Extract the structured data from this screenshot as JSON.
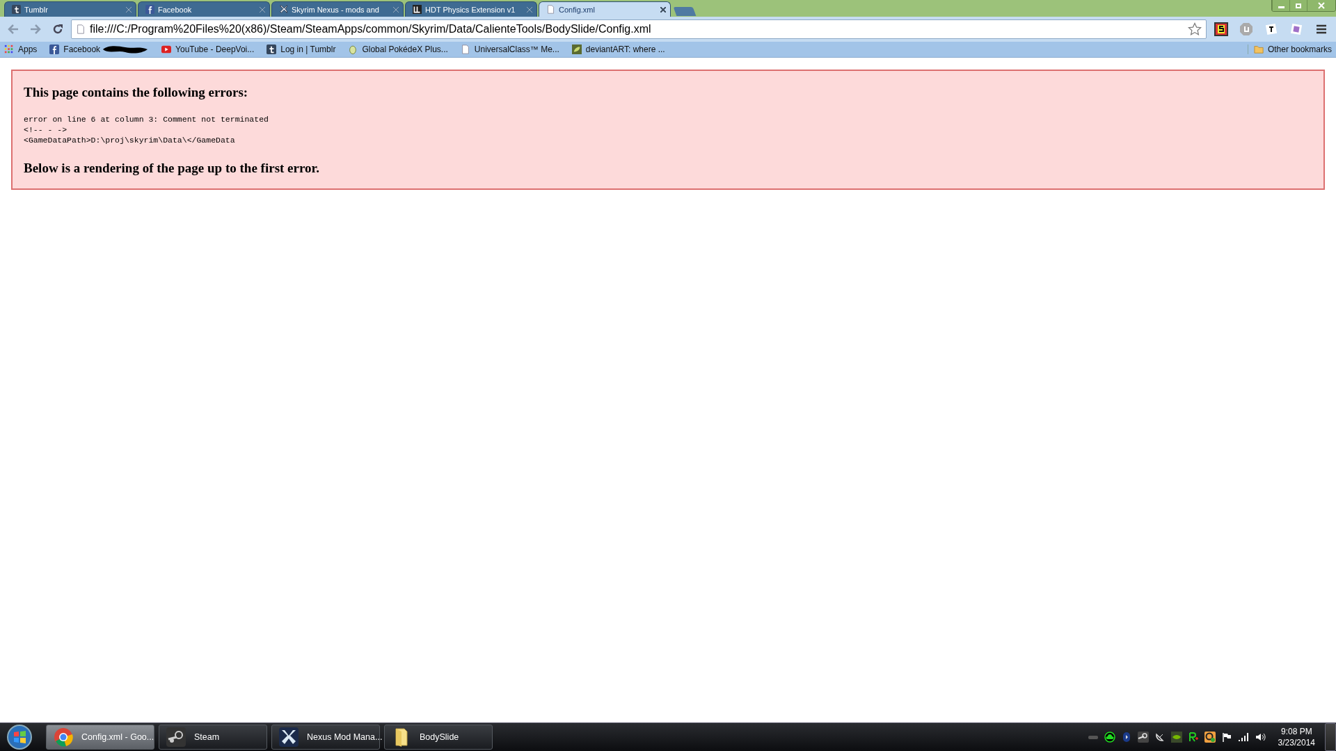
{
  "tabs": [
    {
      "title": "Tumblr",
      "selected": false
    },
    {
      "title": "Facebook",
      "selected": false
    },
    {
      "title": "Skyrim Nexus - mods and",
      "selected": false
    },
    {
      "title": "HDT Physics Extension v1",
      "selected": false
    },
    {
      "title": "Config.xml",
      "selected": true
    }
  ],
  "address": "file:///C:/Program%20Files%20(x86)/Steam/SteamApps/common/Skyrim/Data/CalienteTools/BodySlide/Config.xml",
  "bookmarks": [
    {
      "label": "Apps"
    },
    {
      "label": "Facebook"
    },
    {
      "label": "YouTube - DeepVoi..."
    },
    {
      "label": "Log in | Tumblr"
    },
    {
      "label": "Global PokédeX Plus..."
    },
    {
      "label": "UniversalClass™ Me..."
    },
    {
      "label": "deviantART: where ..."
    }
  ],
  "other_bookmarks": "Other bookmarks",
  "error": {
    "heading": "This page contains the following errors:",
    "lines": [
      "error on line 6 at column 3: Comment not terminated",
      "<!-- - ->",
      "<GameDataPath>D:\\proj\\skyrim\\Data\\</GameData"
    ],
    "footer": "Below is a rendering of the page up to the first error."
  },
  "taskbar": [
    {
      "label": "Config.xml - Goo...",
      "selected": true
    },
    {
      "label": "Steam",
      "selected": false
    },
    {
      "label": "Nexus Mod Mana...",
      "selected": false
    },
    {
      "label": "BodySlide",
      "selected": false
    }
  ],
  "clock": {
    "time": "9:08 PM",
    "date": "3/23/2014"
  }
}
